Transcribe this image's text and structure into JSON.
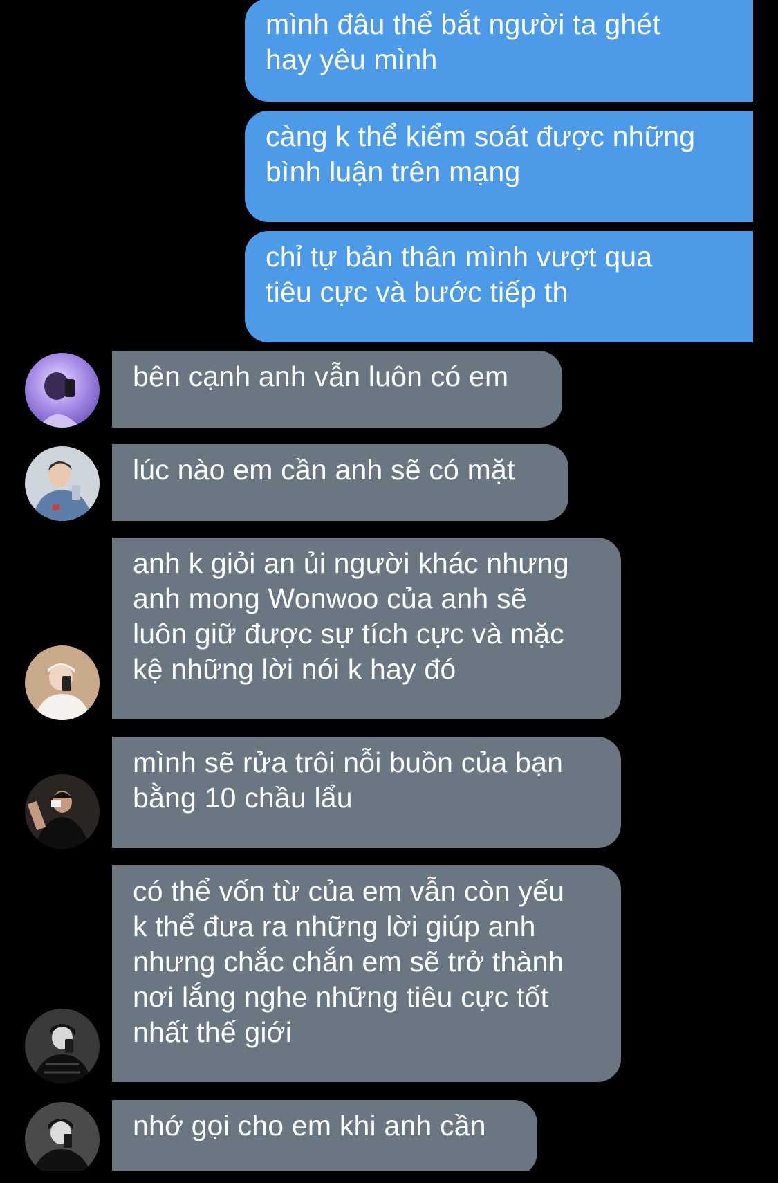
{
  "colors": {
    "background": "#000000",
    "outgoing_bubble": "#4d9be8",
    "incoming_bubble": "#6b7683",
    "text": "#ffffff"
  },
  "messages": [
    {
      "direction": "outgoing",
      "text": "mình đâu thể bắt người ta ghét\nhay yêu mình"
    },
    {
      "direction": "outgoing",
      "text": "càng k thể kiểm soát được những\nbình luận trên mạng"
    },
    {
      "direction": "outgoing",
      "text": "chỉ tự bản thân mình vượt qua\ntiêu cực và bước tiếp th"
    },
    {
      "direction": "incoming",
      "avatar": "avatar-purple-selfie",
      "text": "bên cạnh anh vẫn luôn có em"
    },
    {
      "direction": "incoming",
      "avatar": "avatar-denim-selfie",
      "text": "lúc nào em cần anh sẽ có mặt"
    },
    {
      "direction": "incoming",
      "avatar": "avatar-beanie-selfie",
      "text": "anh k giỏi an ủi người khác nhưng\nanh mong Wonwoo của anh sẽ\nluôn giữ được sự tích cực và mặc\nkệ những lời nói k hay đó"
    },
    {
      "direction": "incoming",
      "avatar": "avatar-dark-mirror",
      "text": "mình sẽ rửa trôi nỗi buồn của bạn\nbằng 10 chầu lẩu"
    },
    {
      "direction": "incoming",
      "avatar": "avatar-bw-jacket",
      "text": "có thể vốn từ của em vẫn còn yếu\nk thể đưa ra những lời giúp anh\nnhưng chắc chắn em sẽ trở thành\nnơi lắng nghe những tiêu cực tốt\nnhất thế giới"
    },
    {
      "direction": "incoming",
      "avatar": "avatar-bw-jacket",
      "text": "nhớ gọi cho em khi anh cần"
    }
  ]
}
